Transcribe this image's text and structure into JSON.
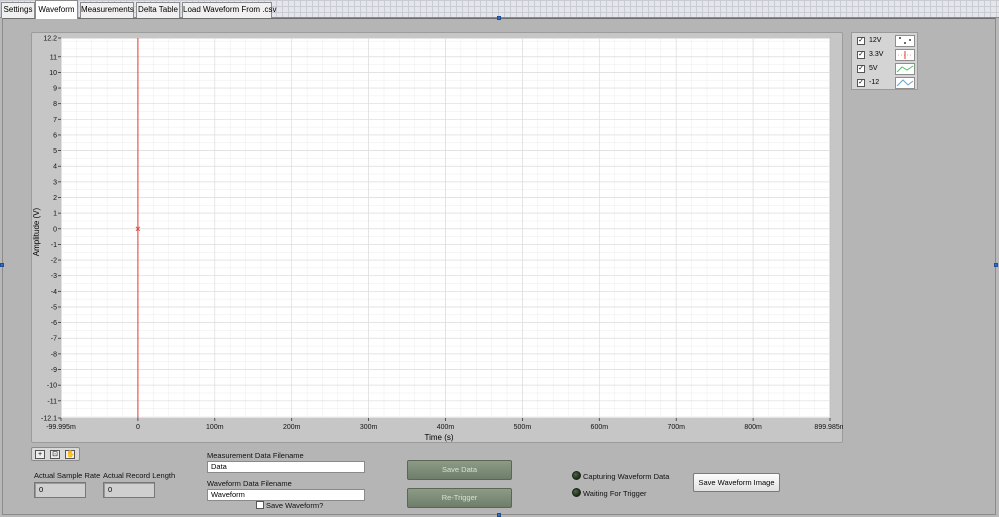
{
  "tabs": [
    {
      "label": "Settings"
    },
    {
      "label": "Waveform"
    },
    {
      "label": "Measurements"
    },
    {
      "label": "Delta Table"
    },
    {
      "label": "Load Waveform From .csv"
    }
  ],
  "graph": {
    "ylabel": "Amplitude (V)",
    "xlabel": "Time (s)",
    "y_ticks": [
      "12.2",
      "11",
      "10",
      "9",
      "8",
      "7",
      "6",
      "5",
      "4",
      "3",
      "2",
      "1",
      "0",
      "-1",
      "-2",
      "-3",
      "-4",
      "-5",
      "-6",
      "-7",
      "-8",
      "-9",
      "-10",
      "-11",
      "-12.1"
    ],
    "x_ticks": [
      "-99.995m",
      "0",
      "100m",
      "200m",
      "300m",
      "400m",
      "500m",
      "600m",
      "700m",
      "800m",
      "899.985m"
    ]
  },
  "chart_data": {
    "type": "line",
    "xlabel": "Time (s)",
    "ylabel": "Amplitude (V)",
    "xlim": [
      -0.099995,
      0.899985
    ],
    "ylim": [
      -12.1,
      12.2
    ],
    "grid": true,
    "x_tick_values": [
      -0.099995,
      0,
      0.1,
      0.2,
      0.3,
      0.4,
      0.5,
      0.6,
      0.7,
      0.8,
      0.899985
    ],
    "y_tick_values": [
      12.2,
      11,
      10,
      9,
      8,
      7,
      6,
      5,
      4,
      3,
      2,
      1,
      0,
      -1,
      -2,
      -3,
      -4,
      -5,
      -6,
      -7,
      -8,
      -9,
      -10,
      -11,
      -12.1
    ],
    "cursor": {
      "x": 0,
      "color": "#e8392f"
    },
    "series": [
      {
        "name": "12V",
        "values": []
      },
      {
        "name": "3.3V",
        "values": []
      },
      {
        "name": "5V",
        "values": []
      },
      {
        "name": "-12",
        "values": []
      }
    ]
  },
  "legend": [
    {
      "name": "12V",
      "checked": "✓",
      "color": "#3a3a3a"
    },
    {
      "name": "3.3V",
      "checked": "✓",
      "color": "#e8392f"
    },
    {
      "name": "5V",
      "checked": "✓",
      "color": "#49c45a"
    },
    {
      "name": "-12",
      "checked": "✓",
      "color": "#6aa4c8"
    }
  ],
  "palette": {
    "icons": [
      "cursor-move-icon",
      "zoom-icon",
      "pan-hand-icon"
    ]
  },
  "indicators": {
    "sample_rate_label": "Actual Sample Rate",
    "sample_rate_value": "0",
    "record_length_label": "Actual Record Length",
    "record_length_value": "0"
  },
  "files": {
    "measurement_label": "Measurement Data Filename",
    "measurement_value": "Data",
    "waveform_label": "Waveform Data Filename",
    "waveform_value": "Waveform",
    "save_waveform_label": "Save Waveform?"
  },
  "buttons": {
    "save_data": "Save Data",
    "retrigger": "Re-Trigger",
    "save_image": "Save Waveform Image"
  },
  "status": {
    "capturing": "Capturing Waveform Data",
    "waiting": "Waiting For Trigger"
  },
  "colors": {
    "cursor": "#e8392f",
    "button_green": "#7d8c78",
    "grid": "#e6e6e6"
  }
}
